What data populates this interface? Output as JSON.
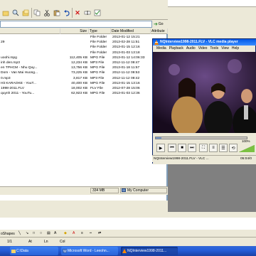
{
  "explorer": {
    "toolbar_icons": [
      "up-folder-icon",
      "search-icon",
      "folders-icon",
      "copy-icon",
      "cut-icon",
      "paste-icon",
      "undo-icon",
      "delete-icon",
      "rename-icon",
      "properties-icon"
    ],
    "go_label": "Go",
    "columns": {
      "size": "Size",
      "type": "Type",
      "date": "Date Modified",
      "attr": "Attribute"
    },
    "rows": [
      {
        "name": "",
        "size": "",
        "type": "File Folder",
        "date": "2013-01-12 15:21"
      },
      {
        "name": "29",
        "size": "",
        "type": "File Folder",
        "date": "2013-02-28 11:51"
      },
      {
        "name": "",
        "size": "",
        "type": "File Folder",
        "date": "2013-01-15 12:16"
      },
      {
        "name": "",
        "size": "",
        "type": "File Folder",
        "date": "2013-01-03 13:18"
      },
      {
        "name": "uoohi.mpg",
        "size": "112,405 KB",
        "type": "MPG File",
        "date": "2013-01-12 14:06:33"
      },
      {
        "name": "inh den.mp3",
        "size": "12,234 KB",
        "type": "MP3 File",
        "date": "2012-11-12 08:47"
      },
      {
        "name": "en TPHCM - Nhu Quy...",
        "size": "13,756 KB",
        "type": "MPG File",
        "date": "2013-01-18 11:57"
      },
      {
        "name": "Dom - Van Mai Huong...",
        "size": "73,225 KB",
        "type": "MPG File",
        "date": "2012-11-12 08:53"
      },
      {
        "name": "0.mp3",
        "size": "3,817 KB",
        "type": "MP3 File",
        "date": "2012-11-12 08:42"
      },
      {
        "name": "Hit KARAOKE - YouT...",
        "size": "40,400 KB",
        "type": "MPG File",
        "date": "2013-01-15 13:16"
      },
      {
        "name": "1998-2011.FLV",
        "size": "18,002 KB",
        "type": "FLV File",
        "date": "2012-07-28 15:06"
      },
      {
        "name": "quynh 2011 - YouTu...",
        "size": "62,923 KB",
        "type": "MPG File",
        "date": "2013-01-03 12:36"
      }
    ],
    "status_size": "334 MB",
    "status_location": "My Computer"
  },
  "vlc": {
    "title": "NQInterview1998-2011.FLV - VLC media player",
    "menu": [
      "Media",
      "Playback",
      "Audio",
      "Video",
      "Tools",
      "View",
      "Help"
    ],
    "status_file": "NQInterview1998-2011.FLV - VLC ...",
    "time": "05:04/0",
    "volume_label": "100%",
    "seek_progress": 0.06,
    "volume_level": 1.0,
    "controls": [
      "play-icon",
      "prev-icon",
      "stop-icon",
      "next-icon",
      "fullscreen-icon",
      "extended-settings-icon",
      "playlist-icon",
      "loop-icon",
      "random-icon"
    ]
  },
  "word": {
    "draw_label": "oShapes",
    "status_page": "1/1",
    "status_at": "At",
    "status_ln": "Ln",
    "status_col": "Col"
  },
  "taskbar": {
    "items": [
      {
        "label": "C:\\Data",
        "icon": "folder-icon",
        "active": false
      },
      {
        "label": "Microsoft Word - Leeohn...",
        "icon": "word-icon",
        "active": false
      },
      {
        "label": "NQInterview1998-2011...",
        "icon": "vlc-icon",
        "active": true
      }
    ]
  },
  "colors": {
    "titlebar": "#0058e6",
    "taskbar": "#245edb",
    "vlc_accent": "#ff8800"
  }
}
